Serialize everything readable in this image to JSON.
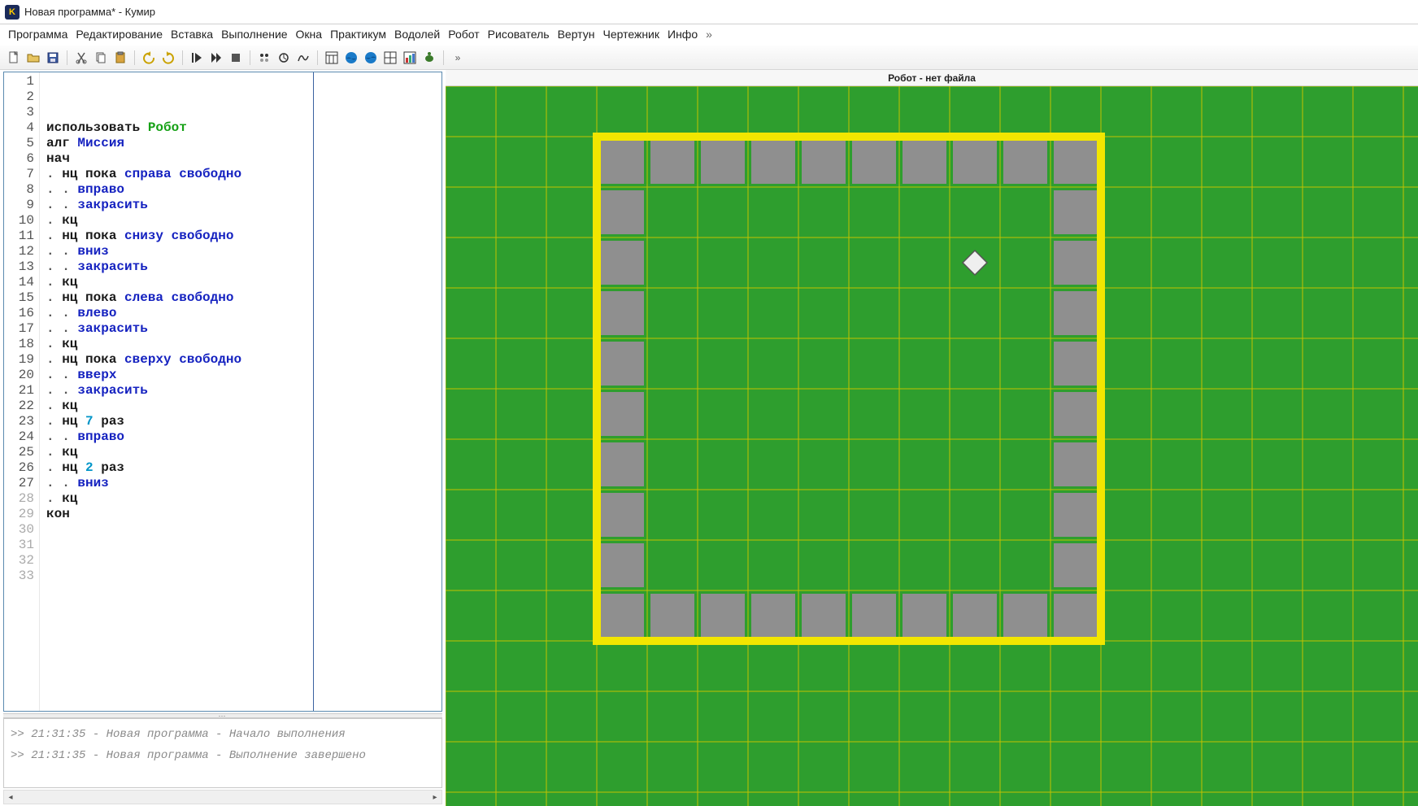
{
  "titlebar": {
    "title": "Новая программа* - Кумир",
    "icon_letter": "K"
  },
  "menubar": [
    "Программа",
    "Редактирование",
    "Вставка",
    "Выполнение",
    "Окна",
    "Практикум",
    "Водолей",
    "Робот",
    "Рисователь",
    "Вертун",
    "Чертежник",
    "Инфо",
    "»"
  ],
  "toolbar": [
    {
      "name": "new-file-icon"
    },
    {
      "name": "open-file-icon"
    },
    {
      "name": "save-file-icon"
    },
    {
      "sep": true
    },
    {
      "name": "cut-icon"
    },
    {
      "name": "copy-icon"
    },
    {
      "name": "paste-icon"
    },
    {
      "sep": true
    },
    {
      "name": "undo-icon"
    },
    {
      "name": "redo-icon"
    },
    {
      "sep": true
    },
    {
      "name": "run-icon"
    },
    {
      "name": "run-step-icon"
    },
    {
      "name": "stop-icon"
    },
    {
      "sep": true
    },
    {
      "name": "toggle-a-icon"
    },
    {
      "name": "toggle-b-icon"
    },
    {
      "name": "toggle-c-icon"
    },
    {
      "sep": true
    },
    {
      "name": "panel-1-icon"
    },
    {
      "name": "actor-blue-icon"
    },
    {
      "name": "actor-blue2-icon"
    },
    {
      "name": "grid-icon"
    },
    {
      "name": "chart-icon"
    },
    {
      "name": "turtle-icon"
    },
    {
      "sep": true
    },
    {
      "name": "overflow-icon"
    }
  ],
  "code": {
    "total_lines": 33,
    "dim_after": 27,
    "lines": [
      [
        [
          "dark",
          "использовать "
        ],
        [
          "green",
          "Робот"
        ]
      ],
      [
        [
          "dark",
          "алг "
        ],
        [
          "blue",
          "Миссия"
        ]
      ],
      [
        [
          "dark",
          "нач"
        ]
      ],
      [
        [
          "dot",
          ". "
        ],
        [
          "dark",
          "нц пока "
        ],
        [
          "blue",
          "справа свободно"
        ]
      ],
      [
        [
          "dot",
          ". . "
        ],
        [
          "blue",
          "вправо"
        ]
      ],
      [
        [
          "dot",
          ". . "
        ],
        [
          "blue",
          "закрасить"
        ]
      ],
      [
        [
          "dot",
          ". "
        ],
        [
          "dark",
          "кц"
        ]
      ],
      [
        [
          "dot",
          ". "
        ],
        [
          "dark",
          "нц пока "
        ],
        [
          "blue",
          "снизу свободно"
        ]
      ],
      [
        [
          "dot",
          ". . "
        ],
        [
          "blue",
          "вниз"
        ]
      ],
      [
        [
          "dot",
          ". . "
        ],
        [
          "blue",
          "закрасить"
        ]
      ],
      [
        [
          "dot",
          ". "
        ],
        [
          "dark",
          "кц"
        ]
      ],
      [
        [
          "dot",
          ". "
        ],
        [
          "dark",
          "нц пока "
        ],
        [
          "blue",
          "слева свободно"
        ]
      ],
      [
        [
          "dot",
          ". . "
        ],
        [
          "blue",
          "влево"
        ]
      ],
      [
        [
          "dot",
          ". . "
        ],
        [
          "blue",
          "закрасить"
        ]
      ],
      [
        [
          "dot",
          ". "
        ],
        [
          "dark",
          "кц"
        ]
      ],
      [
        [
          "dot",
          ". "
        ],
        [
          "dark",
          "нц пока "
        ],
        [
          "blue",
          "сверху свободно"
        ]
      ],
      [
        [
          "dot",
          ". . "
        ],
        [
          "blue",
          "вверх"
        ]
      ],
      [
        [
          "dot",
          ". . "
        ],
        [
          "blue",
          "закрасить"
        ]
      ],
      [
        [
          "dot",
          ". "
        ],
        [
          "dark",
          "кц"
        ]
      ],
      [
        [
          "dot",
          ". "
        ],
        [
          "dark",
          "нц "
        ],
        [
          "cyan",
          "7"
        ],
        [
          "dark",
          " раз"
        ]
      ],
      [
        [
          "dot",
          ". . "
        ],
        [
          "blue",
          "вправо"
        ]
      ],
      [
        [
          "dot",
          ". "
        ],
        [
          "dark",
          "кц"
        ]
      ],
      [
        [
          "dot",
          ". "
        ],
        [
          "dark",
          "нц "
        ],
        [
          "cyan",
          "2"
        ],
        [
          "dark",
          " раз"
        ]
      ],
      [
        [
          "dot",
          ". . "
        ],
        [
          "blue",
          "вниз"
        ]
      ],
      [
        [
          "dot",
          ". "
        ],
        [
          "dark",
          "кц"
        ]
      ],
      [
        [
          "dark",
          "кон"
        ]
      ],
      []
    ]
  },
  "console": [
    ">> 21:31:35 - Новая программа - Начало выполнения",
    ">> 21:31:35 - Новая программа - Выполнение завершено"
  ],
  "robot": {
    "title": "Робот - нет файла",
    "field": {
      "cols": 19,
      "rows": 14,
      "wall_origin_col": 3,
      "wall_origin_row": 1,
      "wall_cols": 10,
      "wall_rows": 10,
      "painted": [
        [
          3,
          1
        ],
        [
          4,
          1
        ],
        [
          5,
          1
        ],
        [
          6,
          1
        ],
        [
          7,
          1
        ],
        [
          8,
          1
        ],
        [
          9,
          1
        ],
        [
          10,
          1
        ],
        [
          11,
          1
        ],
        [
          12,
          1
        ],
        [
          12,
          2
        ],
        [
          12,
          3
        ],
        [
          12,
          4
        ],
        [
          12,
          5
        ],
        [
          12,
          6
        ],
        [
          12,
          7
        ],
        [
          12,
          8
        ],
        [
          12,
          9
        ],
        [
          12,
          10
        ],
        [
          11,
          10
        ],
        [
          10,
          10
        ],
        [
          9,
          10
        ],
        [
          8,
          10
        ],
        [
          7,
          10
        ],
        [
          6,
          10
        ],
        [
          5,
          10
        ],
        [
          4,
          10
        ],
        [
          3,
          10
        ],
        [
          3,
          9
        ],
        [
          3,
          8
        ],
        [
          3,
          7
        ],
        [
          3,
          6
        ],
        [
          3,
          5
        ],
        [
          3,
          4
        ],
        [
          3,
          3
        ],
        [
          3,
          2
        ]
      ],
      "robot_pos": [
        10,
        3
      ]
    }
  }
}
